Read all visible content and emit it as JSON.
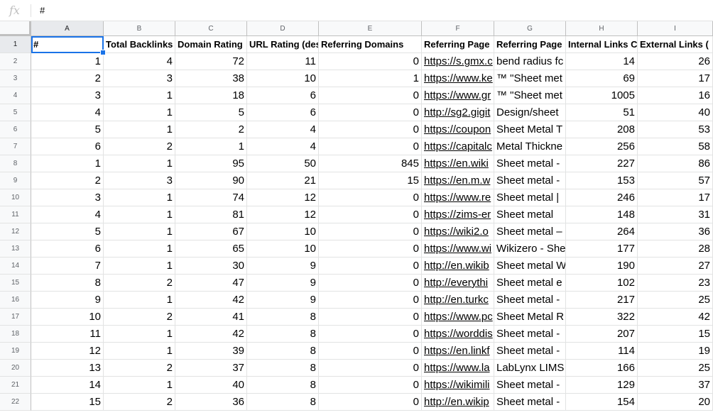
{
  "formula_bar": {
    "fx_label": "fx",
    "value": "#"
  },
  "columns": [
    "A",
    "B",
    "C",
    "D",
    "E",
    "F",
    "G",
    "H",
    "I"
  ],
  "row_numbers": [
    "1",
    "2",
    "3",
    "4",
    "5",
    "6",
    "7",
    "8",
    "9",
    "10",
    "11",
    "12",
    "13",
    "14",
    "15",
    "16",
    "17",
    "18",
    "19",
    "20",
    "21",
    "22"
  ],
  "header_row": [
    "#",
    "Total Backlinks",
    "Domain Rating",
    "URL Rating (des",
    "Referring Domains",
    "Referring Page",
    "Referring Page",
    "Internal Links C",
    "External Links ("
  ],
  "rows": [
    [
      "1",
      "4",
      "72",
      "11",
      "0",
      "https://s.gmx.c",
      "bend radius fc",
      "14",
      "26"
    ],
    [
      "2",
      "3",
      "38",
      "10",
      "1",
      "https://www.ke",
      "™ \"Sheet met",
      "69",
      "17"
    ],
    [
      "3",
      "1",
      "18",
      "6",
      "0",
      "https://www.gr",
      "™ \"Sheet met",
      "1005",
      "16"
    ],
    [
      "4",
      "1",
      "5",
      "6",
      "0",
      "http://sg2.gigit",
      "Design/sheet",
      "51",
      "40"
    ],
    [
      "5",
      "1",
      "2",
      "4",
      "0",
      "https://coupon",
      "Sheet Metal T",
      "208",
      "53"
    ],
    [
      "6",
      "2",
      "1",
      "4",
      "0",
      "https://capitalc",
      "Metal Thickne",
      "256",
      "58"
    ],
    [
      "1",
      "1",
      "95",
      "50",
      "845",
      "https://en.wiki",
      "Sheet metal -",
      "227",
      "86"
    ],
    [
      "2",
      "3",
      "90",
      "21",
      "15",
      "https://en.m.w",
      "Sheet metal -",
      "153",
      "57"
    ],
    [
      "3",
      "1",
      "74",
      "12",
      "0",
      "https://www.re",
      "Sheet metal |",
      "246",
      "17"
    ],
    [
      "4",
      "1",
      "81",
      "12",
      "0",
      "https://zims-er",
      "Sheet metal",
      "148",
      "31"
    ],
    [
      "5",
      "1",
      "67",
      "10",
      "0",
      "https://wiki2.o",
      "Sheet metal –",
      "264",
      "36"
    ],
    [
      "6",
      "1",
      "65",
      "10",
      "0",
      "https://www.wi",
      "Wikizero - She",
      "177",
      "28"
    ],
    [
      "7",
      "1",
      "30",
      "9",
      "0",
      "http://en.wikib",
      "Sheet metal W",
      "190",
      "27"
    ],
    [
      "8",
      "2",
      "47",
      "9",
      "0",
      "http://everythi",
      "Sheet metal e",
      "102",
      "23"
    ],
    [
      "9",
      "1",
      "42",
      "9",
      "0",
      "http://en.turkc",
      "Sheet metal -",
      "217",
      "25"
    ],
    [
      "10",
      "2",
      "41",
      "8",
      "0",
      "https://www.pc",
      "Sheet Metal R",
      "322",
      "42"
    ],
    [
      "11",
      "1",
      "42",
      "8",
      "0",
      "https://worddis",
      "Sheet metal -",
      "207",
      "15"
    ],
    [
      "12",
      "1",
      "39",
      "8",
      "0",
      "https://en.linkf",
      "Sheet metal -",
      "114",
      "19"
    ],
    [
      "13",
      "2",
      "37",
      "8",
      "0",
      "https://www.la",
      "LabLynx LIMS",
      "166",
      "25"
    ],
    [
      "14",
      "1",
      "40",
      "8",
      "0",
      "https://wikimili",
      "Sheet metal -",
      "129",
      "37"
    ],
    [
      "15",
      "2",
      "36",
      "8",
      "0",
      "http://en.wikip",
      "Sheet metal -",
      "154",
      "20"
    ]
  ],
  "colors": {
    "selection": "#1a73e8",
    "header_bg": "#f8f9fa",
    "grid_line": "#e2e3e3"
  }
}
